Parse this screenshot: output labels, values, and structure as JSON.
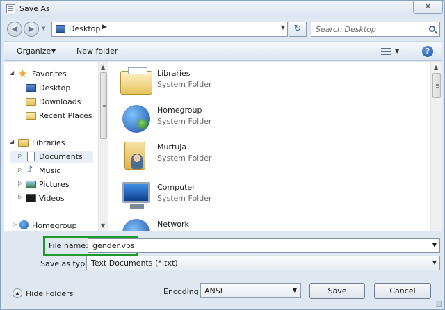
{
  "window": {
    "title": "Save As",
    "close_glyph": "✕"
  },
  "navigation": {
    "back_glyph": "◀",
    "forward_glyph": "▶",
    "history_glyph": "▼",
    "address": "Desktop",
    "address_separator": "▶",
    "address_dropdown": "▼",
    "refresh_glyph": "↻",
    "search_placeholder": "Search Desktop"
  },
  "toolbar": {
    "organize_label": "Organize",
    "organize_caret": "▼",
    "new_folder_label": "New folder",
    "view_caret": "▼",
    "help_glyph": "?"
  },
  "sidebar": {
    "items": [
      {
        "label": "Favorites",
        "icon": "star-icon",
        "expander": "◢"
      },
      {
        "label": "Desktop",
        "icon": "desktop-icon"
      },
      {
        "label": "Downloads",
        "icon": "folder-icon"
      },
      {
        "label": "Recent Places",
        "icon": "recent-places-icon"
      },
      {
        "label": "Libraries",
        "icon": "libraries-icon",
        "expander": "◢"
      },
      {
        "label": "Documents",
        "icon": "documents-icon",
        "expander": "▷"
      },
      {
        "label": "Music",
        "icon": "music-icon",
        "expander": "▷"
      },
      {
        "label": "Pictures",
        "icon": "pictures-icon",
        "expander": "▷"
      },
      {
        "label": "Videos",
        "icon": "videos-icon",
        "expander": "▷"
      },
      {
        "label": "Homegroup",
        "icon": "homegroup-icon",
        "expander": "▷"
      }
    ],
    "scroll_up": "▲",
    "scroll_down": "▼"
  },
  "files": [
    {
      "name": "Libraries",
      "type": "System Folder",
      "icon": "libraries-icon"
    },
    {
      "name": "Homegroup",
      "type": "System Folder",
      "icon": "homegroup-icon"
    },
    {
      "name": "Murtuja",
      "type": "System Folder",
      "icon": "user-folder-icon"
    },
    {
      "name": "Computer",
      "type": "System Folder",
      "icon": "computer-icon"
    },
    {
      "name": "Network",
      "type": "",
      "icon": "network-icon"
    }
  ],
  "content_scroll_up": "▲",
  "form": {
    "file_name_label": "File name:",
    "file_name_value": "gender.vbs",
    "file_name_dropdown": "▼",
    "save_as_type_label": "Save as type:",
    "save_as_type_value": "Text Documents (*.txt)",
    "save_as_type_dropdown": "▼",
    "encoding_label": "Encoding:",
    "encoding_value": "ANSI",
    "encoding_dropdown": "▼"
  },
  "footer": {
    "hide_folders_label": "Hide Folders",
    "hide_folders_glyph": "▲",
    "save_label": "Save",
    "cancel_label": "Cancel"
  },
  "colors": {
    "highlight": "#1e9a2a",
    "window_frame": "#dfe8f1",
    "accent": "#2a66b8"
  }
}
